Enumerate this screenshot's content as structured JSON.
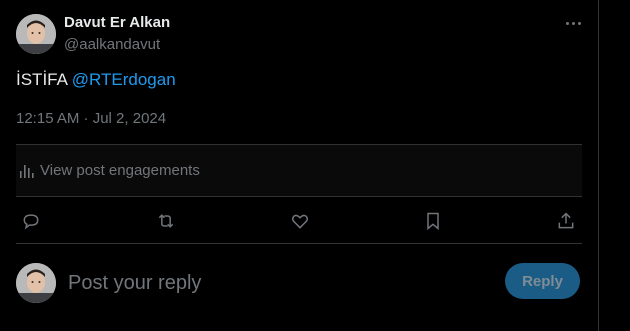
{
  "author": {
    "display_name": "Davut Er Alkan",
    "handle": "@aalkandavut"
  },
  "tweet": {
    "text_prefix": "İSTİFA",
    "mention": "@RTErdogan",
    "timestamp": "12:15 AM · Jul 2, 2024"
  },
  "engagements": {
    "label": "View post engagements",
    "icon": "analytics-icon"
  },
  "actions": [
    {
      "name": "reply",
      "icon": "reply-icon"
    },
    {
      "name": "repost",
      "icon": "repost-icon"
    },
    {
      "name": "like",
      "icon": "heart-icon"
    },
    {
      "name": "bookmark",
      "icon": "bookmark-icon"
    },
    {
      "name": "share",
      "icon": "share-icon"
    }
  ],
  "composer": {
    "placeholder": "Post your reply",
    "button_label": "Reply"
  },
  "colors": {
    "background": "#000000",
    "text": "#e7e9ea",
    "secondary": "#71767b",
    "accent": "#1d9bf0",
    "reply_button_disabled": "#1a5c86"
  }
}
